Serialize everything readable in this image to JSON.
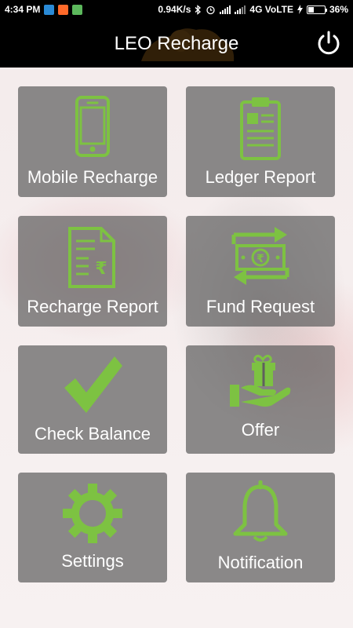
{
  "status_bar": {
    "time": "4:34 PM",
    "network_speed": "0.94K/s",
    "network_type": "4G VoLTE",
    "battery": "36%",
    "battery_level": 0.36
  },
  "app_bar": {
    "title": "LEO Recharge"
  },
  "colors": {
    "accent_green": "#7dc242",
    "tile_bg": "#5f5f5f",
    "app_bar_bg": "#000000"
  },
  "tiles": [
    {
      "label": "Mobile Recharge",
      "icon": "mobile-phone-icon"
    },
    {
      "label": "Ledger Report",
      "icon": "clipboard-icon"
    },
    {
      "label": "Recharge Report",
      "icon": "rupee-document-icon"
    },
    {
      "label": "Fund Request",
      "icon": "money-exchange-icon"
    },
    {
      "label": "Check Balance",
      "icon": "checkmark-icon"
    },
    {
      "label": "Offer",
      "icon": "gift-hand-icon"
    },
    {
      "label": "Settings",
      "icon": "gear-icon"
    },
    {
      "label": "Notification",
      "icon": "bell-icon"
    }
  ]
}
